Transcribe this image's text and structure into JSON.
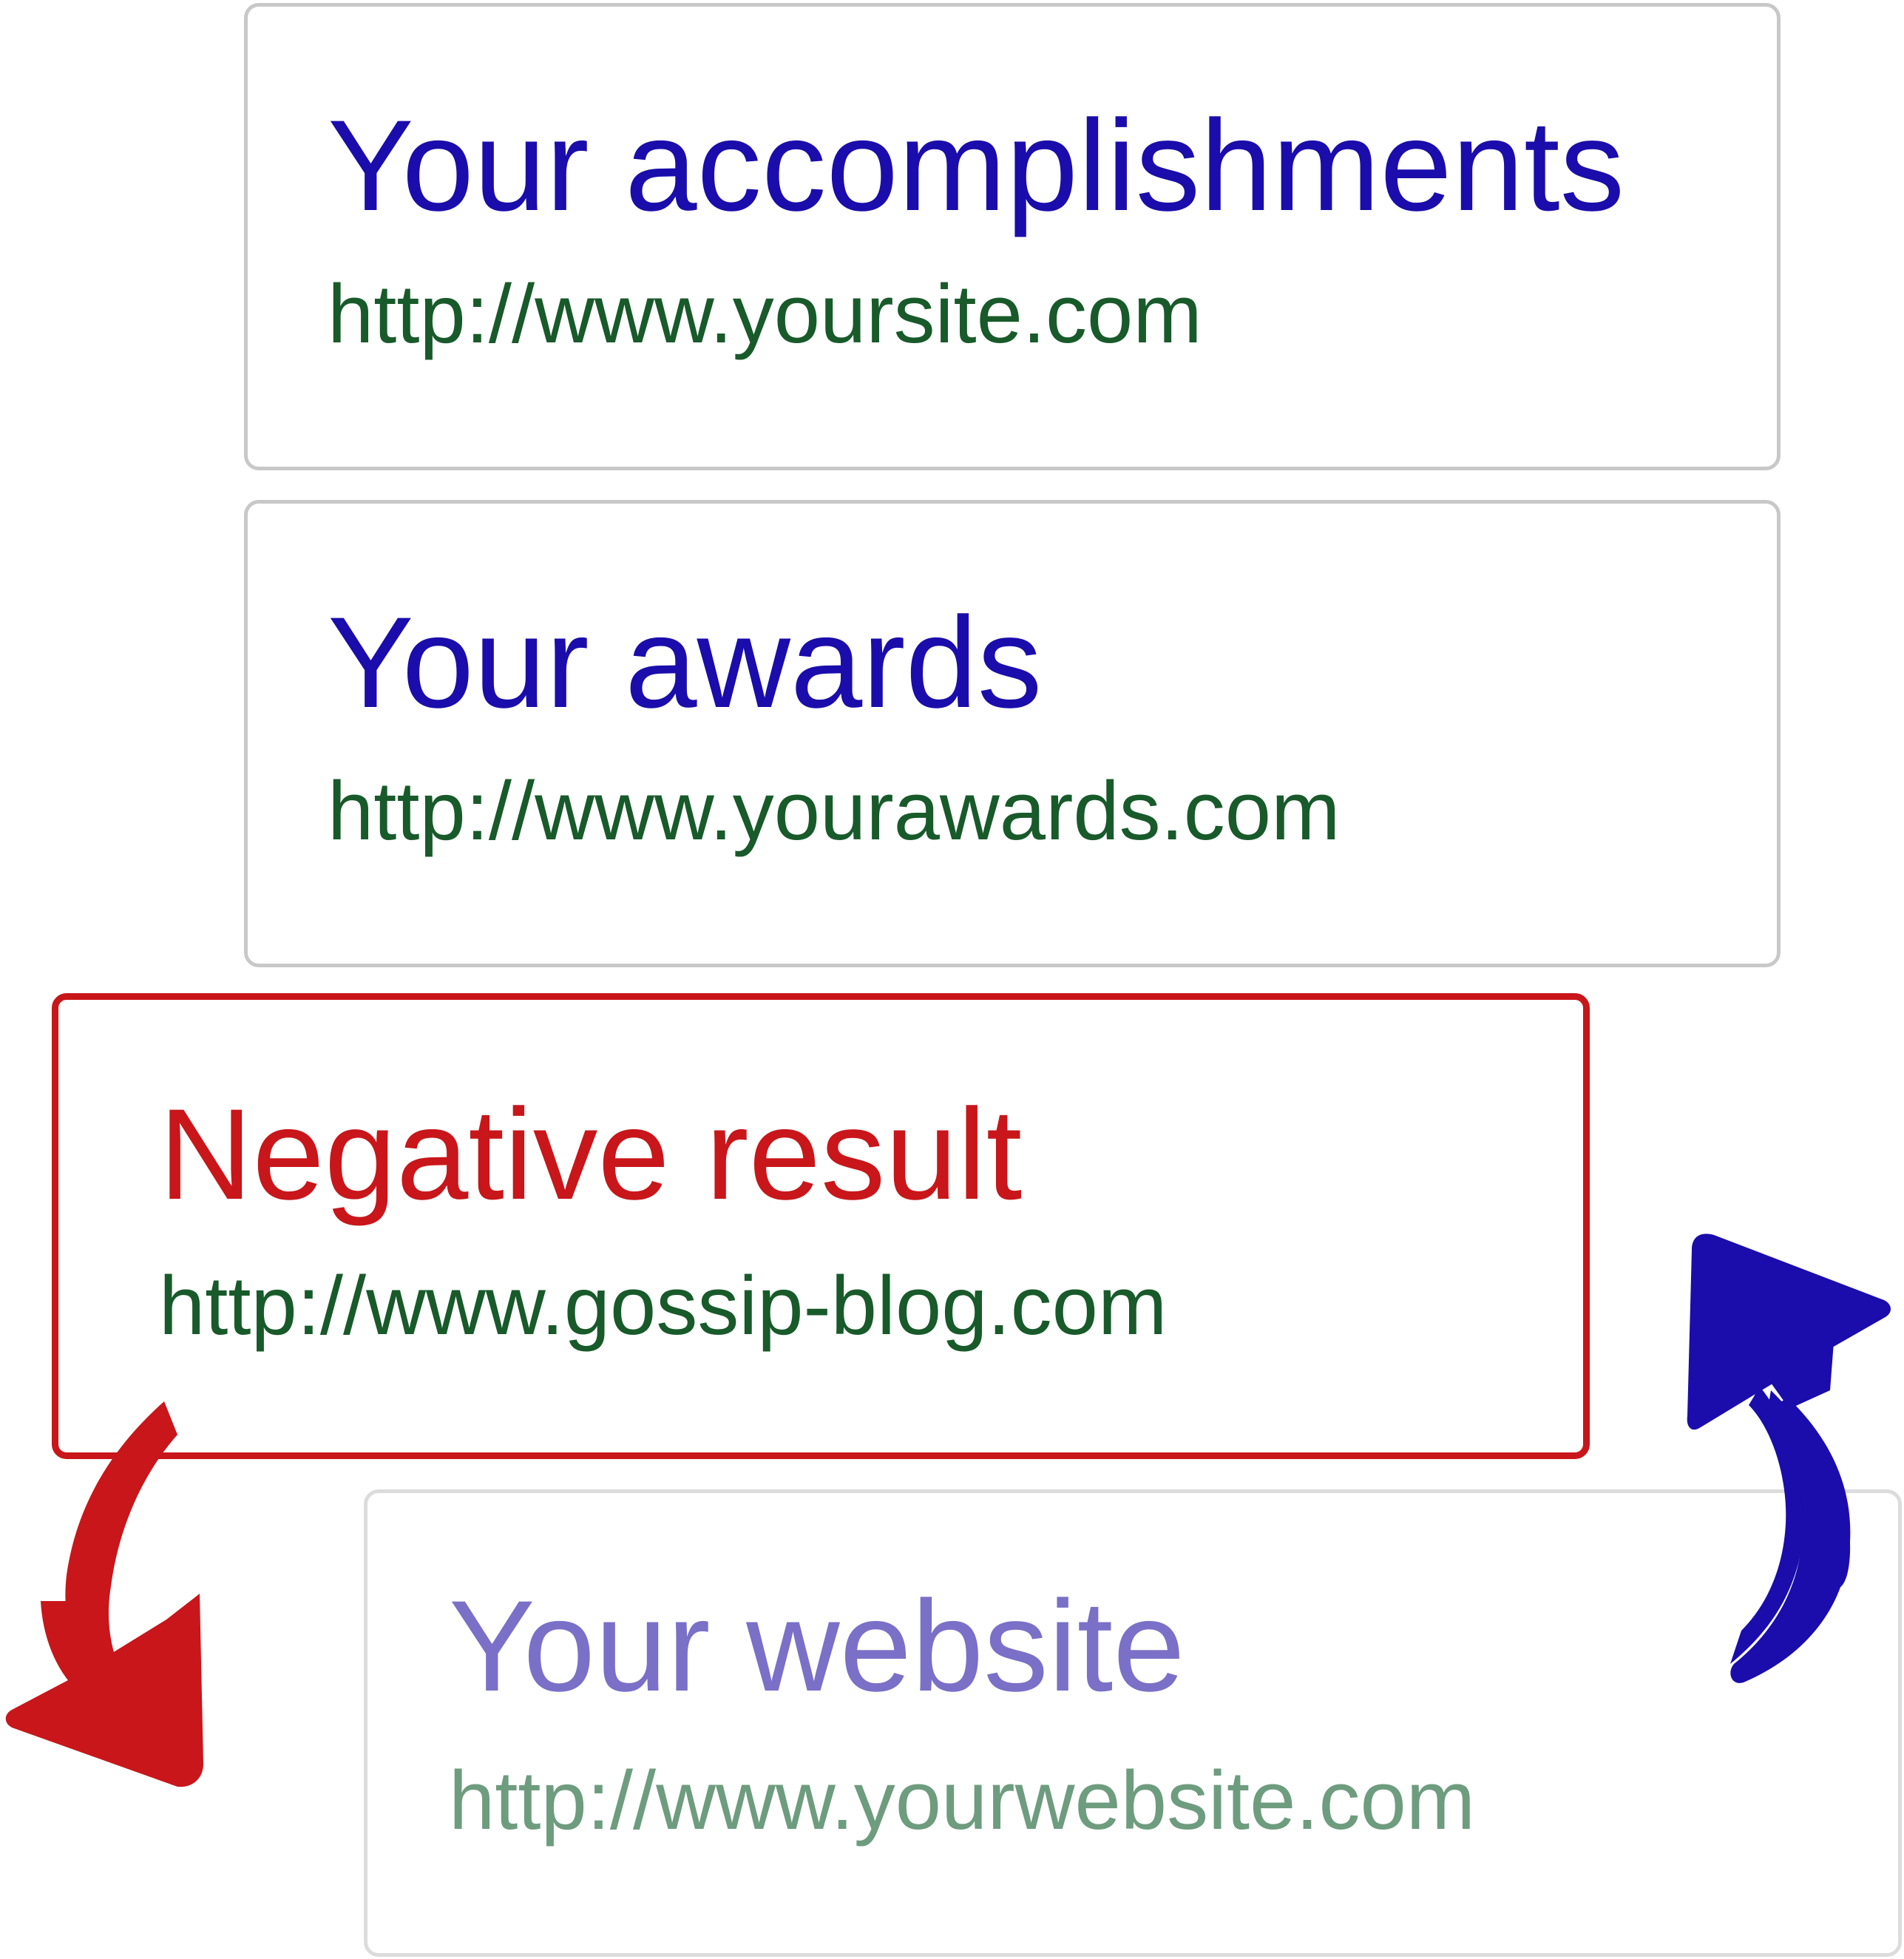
{
  "results": [
    {
      "title": "Your accomplishments",
      "url": "http://www.yoursite.com"
    },
    {
      "title": "Your awards",
      "url": "http://www.yourawards.com"
    },
    {
      "title": "Negative result",
      "url": "http://www.gossip-blog.com"
    },
    {
      "title": "Your website",
      "url": "http://www.yourwebsite.com"
    }
  ],
  "colors": {
    "title_link": "#1a0dab",
    "url_green": "#185a2a",
    "negative_red": "#c8161a",
    "faded_title": "#7a70c8",
    "faded_url": "#6e9c7e",
    "card_border": "#c8c8c8",
    "arrow_down": "#c8161a",
    "arrow_up": "#1a0dab"
  },
  "icons": {
    "down_arrow": "curved-down-arrow-icon",
    "up_arrow": "curved-up-arrow-icon"
  }
}
